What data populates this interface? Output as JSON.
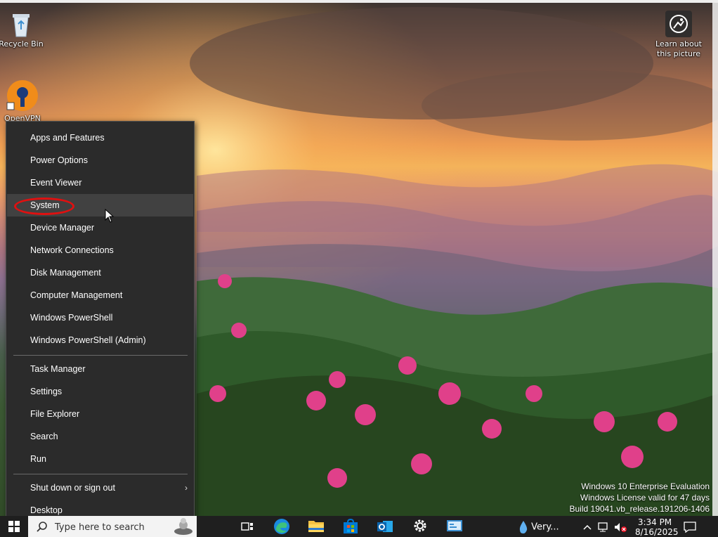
{
  "desktop": {
    "icons": [
      {
        "label": "Recycle Bin",
        "icon": "recycle-bin-icon"
      },
      {
        "label": "OpenVPN GUI",
        "icon": "openvpn-icon"
      },
      {
        "label": "Learn about this picture",
        "icon": "learn-picture-icon"
      }
    ]
  },
  "context_menu": {
    "items_group1": [
      "Apps and Features",
      "Power Options",
      "Event Viewer",
      "System",
      "Device Manager",
      "Network Connections",
      "Disk Management",
      "Computer Management",
      "Windows PowerShell",
      "Windows PowerShell (Admin)"
    ],
    "items_group2": [
      "Task Manager",
      "Settings",
      "File Explorer",
      "Search",
      "Run"
    ],
    "items_group3": [
      "Shut down or sign out",
      "Desktop"
    ],
    "highlighted_item": "System"
  },
  "watermark": {
    "line1": "Windows 10 Enterprise Evaluation",
    "line2": "Windows License valid for 47 days",
    "line3": "Build 19041.vb_release.191206-1406"
  },
  "taskbar": {
    "search_placeholder": "Type here to search",
    "weather_text": "Very...",
    "time": "3:34 PM",
    "date": "8/16/2025",
    "pinned_icons": [
      "task-view-icon",
      "edge-icon",
      "file-explorer-icon",
      "store-icon",
      "outlook-icon",
      "settings-gear-icon",
      "control-panel-icon"
    ]
  },
  "colors": {
    "menu_bg": "#2b2b2b",
    "menu_hover": "#414141",
    "highlight_ring": "#e01010",
    "taskbar_bg": "#1f1f1f"
  }
}
